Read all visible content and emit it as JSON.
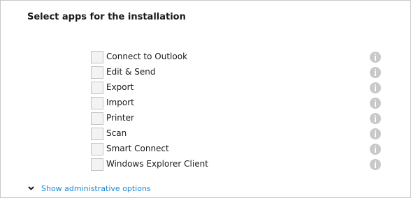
{
  "title": "Select apps for the installation",
  "apps": [
    {
      "label": "Connect to Outlook",
      "checked": false
    },
    {
      "label": "Edit & Send",
      "checked": false
    },
    {
      "label": "Export",
      "checked": false
    },
    {
      "label": "Import",
      "checked": false
    },
    {
      "label": "Printer",
      "checked": false
    },
    {
      "label": "Scan",
      "checked": false
    },
    {
      "label": "Smart Connect",
      "checked": false
    },
    {
      "label": "Windows Explorer Client",
      "checked": false
    }
  ],
  "admin_link": "Show administrative options",
  "icons": {
    "info": "info-icon",
    "expand": "chevron-down-icon"
  },
  "colors": {
    "link": "#1a8ad6",
    "info_icon": "#c9c9c9"
  }
}
